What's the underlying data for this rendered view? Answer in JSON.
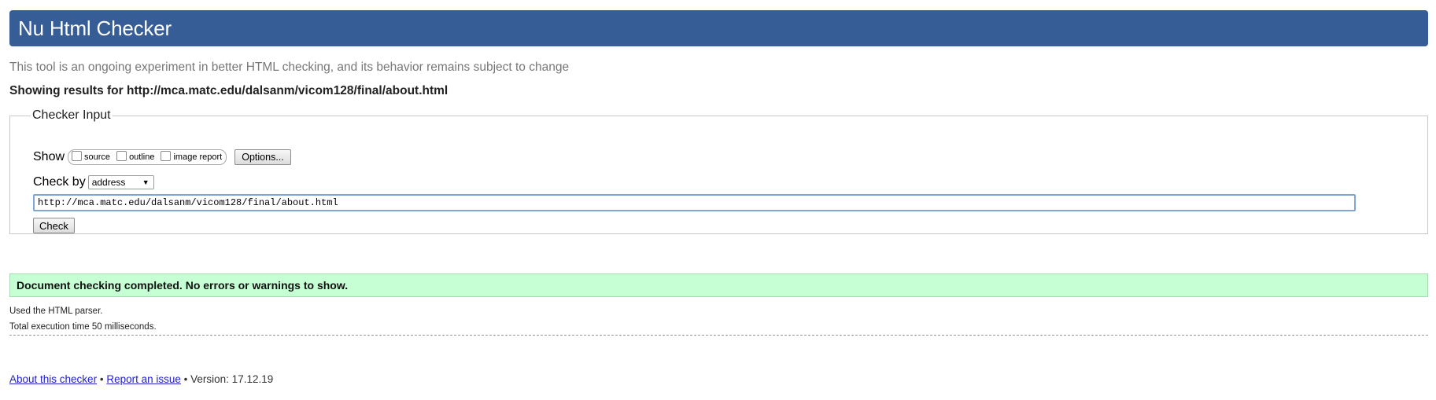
{
  "header": {
    "title": "Nu Html Checker"
  },
  "tagline": "This tool is an ongoing experiment in better HTML checking, and its behavior remains subject to change",
  "results_for": "Showing results for http://mca.matc.edu/dalsanm/vicom128/final/about.html",
  "checker_input": {
    "legend": "Checker Input",
    "show_label": "Show",
    "show_options": [
      {
        "label": "source",
        "checked": false
      },
      {
        "label": "outline",
        "checked": false
      },
      {
        "label": "image report",
        "checked": false
      }
    ],
    "options_button": "Options...",
    "check_by_label": "Check by",
    "check_by_selected": "address",
    "url_value": "http://mca.matc.edu/dalsanm/vicom128/final/about.html",
    "check_button": "Check"
  },
  "result": {
    "message": "Document checking completed. No errors or warnings to show.",
    "parser": "Used the HTML parser.",
    "execution_time": "Total execution time 50 milliseconds."
  },
  "footer": {
    "about_link": "About this checker",
    "separator": "•",
    "report_link": "Report an issue",
    "version": "Version: 17.12.19"
  },
  "colors": {
    "banner": "#365d95",
    "success_bg": "#c6ffd4",
    "link": "#2020cc"
  }
}
